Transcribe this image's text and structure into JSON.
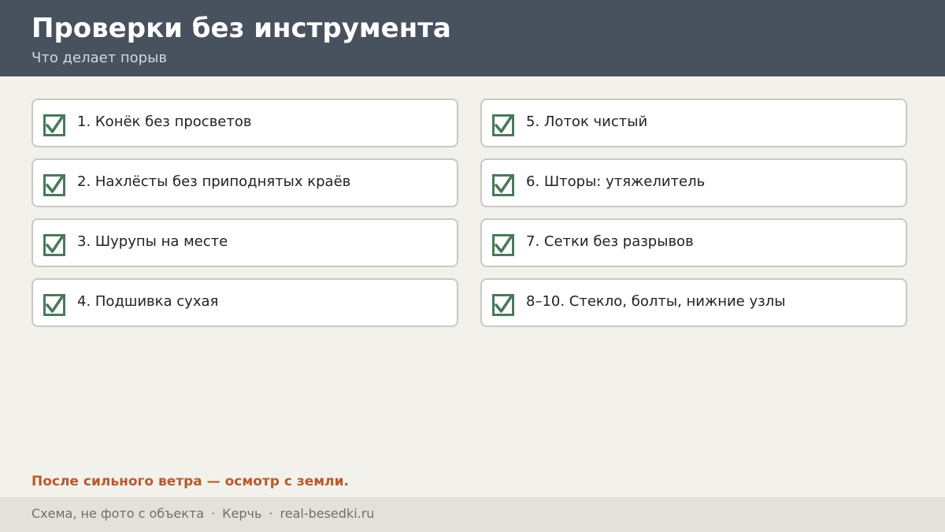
{
  "header": {
    "title": "Проверки без инструмента",
    "subtitle": "Что делает порыв"
  },
  "checklist": {
    "items": [
      {
        "label": "1. Конёк без просветов",
        "checked": true
      },
      {
        "label": "2. Нахлёсты без приподнятых краёв",
        "checked": true
      },
      {
        "label": "3. Шурупы на месте",
        "checked": true
      },
      {
        "label": "4. Подшивка сухая",
        "checked": true
      },
      {
        "label": "5. Лоток чистый",
        "checked": true
      },
      {
        "label": "6. Шторы: утяжелитель",
        "checked": true
      },
      {
        "label": "7. Сетки без разрывов",
        "checked": true
      },
      {
        "label": "8–10. Стекло, болты, нижние узлы",
        "checked": true
      }
    ],
    "check_icon": "checkbox-checked-icon"
  },
  "note": "После сильного ветра — осмотр с земли.",
  "footer": {
    "parts": [
      "Схема, не фото с объекта",
      "Керчь",
      "real-besedki.ru"
    ],
    "separator": "·"
  },
  "colors": {
    "header_bg": "#48515e",
    "page_bg": "#f3f1ec",
    "check": "#4a7a5a",
    "accent": "#b95a2c",
    "footer_bg": "#e4e1db"
  }
}
